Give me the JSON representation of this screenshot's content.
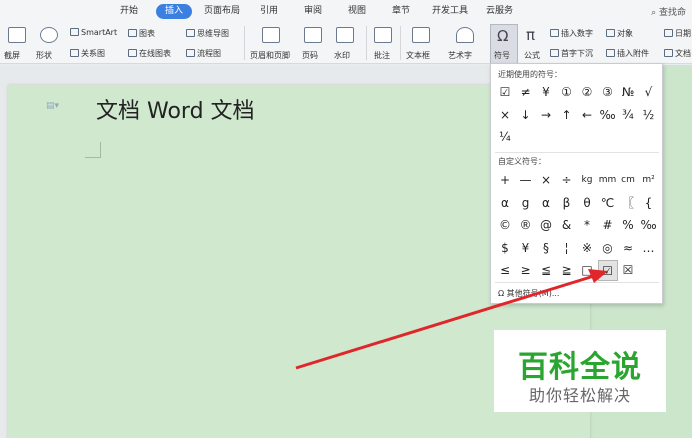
{
  "menu": {
    "tabs": [
      "开始",
      "插入",
      "页面布局",
      "引用",
      "审阅",
      "视图",
      "章节",
      "开发工具",
      "云服务"
    ],
    "active_tab": "插入",
    "search_label": "查找命"
  },
  "ribbon": {
    "screenshot": "截屏",
    "shape": "形状",
    "smartart": "SmartArt",
    "relation": "关系图",
    "chart": "图表",
    "online_chart": "在线图表",
    "mindmap": "思维导图",
    "flowchart": "流程图",
    "header_footer": "页眉和页脚",
    "page_number": "页码",
    "watermark": "水印",
    "comment": "批注",
    "textbox": "文本框",
    "wordart": "艺术字",
    "symbol": "符号",
    "formula": "公式",
    "insert_number": "插入数字",
    "object": "对象",
    "dropcap": "首字下沉",
    "attachment": "插入附件",
    "date": "日期",
    "document": "文档"
  },
  "document": {
    "text": "文档 Word 文档"
  },
  "symbol_panel": {
    "recent_heading": "近期使用的符号：",
    "recent_symbols": [
      "☑",
      "≠",
      "¥",
      "①",
      "②",
      "③",
      "№",
      "√",
      "×",
      "↓",
      "→",
      "↑",
      "←",
      "‰",
      "¾",
      "½",
      "¼"
    ],
    "custom_heading": "自定义符号：",
    "custom_symbols": [
      "+",
      "—",
      "×",
      "÷",
      "kg",
      "mm",
      "cm",
      "m²",
      "α",
      "g",
      "α",
      "β",
      "θ",
      "℃",
      "〖",
      "{",
      "©",
      "®",
      "@",
      "&",
      "*",
      "#",
      "%",
      "‰",
      "$",
      "¥",
      "§",
      "¦",
      "※",
      "◎",
      "≈",
      "…",
      "≤",
      "≥",
      "≦",
      "≧",
      "□",
      "☑",
      "☒"
    ],
    "selected_symbol": "☑",
    "more_label": "其他符号(M)..."
  },
  "watermark": {
    "title": "百科全说",
    "subtitle": "助你轻松解决"
  },
  "colors": {
    "active_tab": "#3b7fe0",
    "page_bg": "#cfe8ce",
    "arrow": "#e0262a",
    "watermark_green": "#2aa52f"
  }
}
